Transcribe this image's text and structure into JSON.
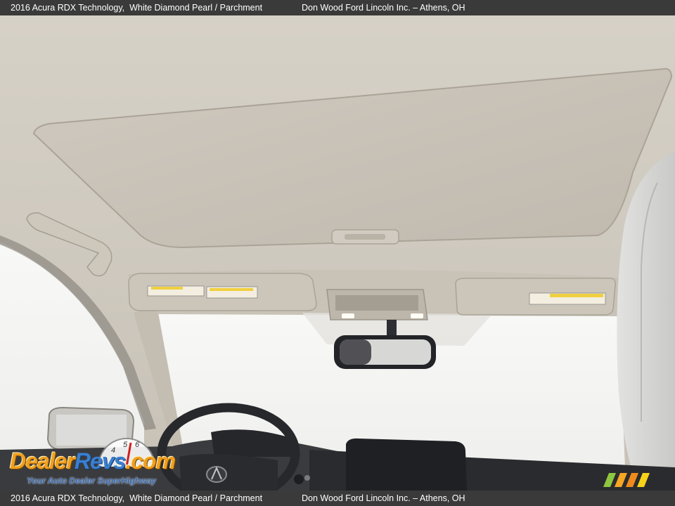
{
  "caption": {
    "vehicle": "2016 Acura RDX Technology,",
    "colors": "White Diamond Pearl / Parchment",
    "dealer": "Don Wood Ford Lincoln Inc. – Athens, OH"
  },
  "watermark": {
    "brand": "DealerRevs.com",
    "tagline": "Your Auto Dealer SuperHighway"
  },
  "scene": {
    "subject": "interior-headliner-sunroof",
    "colors": {
      "headliner": "#cfc9bf",
      "sunroof_panel": "#c8c2b8",
      "window_glare": "#f7f7f6",
      "dashboard": "#2a2b2e",
      "caption_bar": "#3a3a3a"
    }
  }
}
